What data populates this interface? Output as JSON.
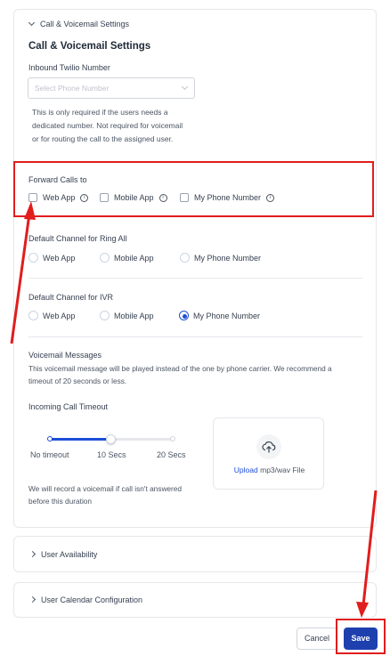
{
  "section": {
    "collapse_title": "Call & Voicemail Settings",
    "heading": "Call & Voicemail Settings"
  },
  "inbound": {
    "label": "Inbound Twilio Number",
    "placeholder": "Select Phone Number",
    "help_line1": "This is only required if the users needs a",
    "help_line2": "dedicated number. Not required for voicemail",
    "help_line3": "or for routing the call to the assigned user."
  },
  "forward": {
    "label": "Forward Calls to",
    "options": [
      {
        "label": "Web App",
        "checked": false
      },
      {
        "label": "Mobile App",
        "checked": false
      },
      {
        "label": "My Phone Number",
        "checked": false
      }
    ]
  },
  "ring_all": {
    "label": "Default Channel for Ring All",
    "options": [
      "Web App",
      "Mobile App",
      "My Phone Number"
    ],
    "selected": null
  },
  "ivr": {
    "label": "Default Channel for IVR",
    "options": [
      "Web App",
      "Mobile App",
      "My Phone Number"
    ],
    "selected": "My Phone Number"
  },
  "voicemail": {
    "label": "Voicemail Messages",
    "desc_line1": "This voicemail message will be played instead of the one by phone carrier. We recommend a",
    "desc_line2": "timeout of 20 seconds or less."
  },
  "timeout": {
    "label": "Incoming Call Timeout",
    "ticks": [
      "No timeout",
      "10 Secs",
      "20 Secs"
    ],
    "value": "10 Secs",
    "note_line1": "We will record a voicemail if call isn't answered",
    "note_line2": "before this duration"
  },
  "upload": {
    "link": "Upload",
    "text": "mp3/wav File"
  },
  "collapsed_sections": [
    "User Availability",
    "User Calendar Configuration"
  ],
  "footer": {
    "cancel": "Cancel",
    "save": "Save"
  },
  "colors": {
    "accent": "#1d4ed8",
    "annotation": "#e11d1d",
    "save_bg": "#1e40af"
  }
}
